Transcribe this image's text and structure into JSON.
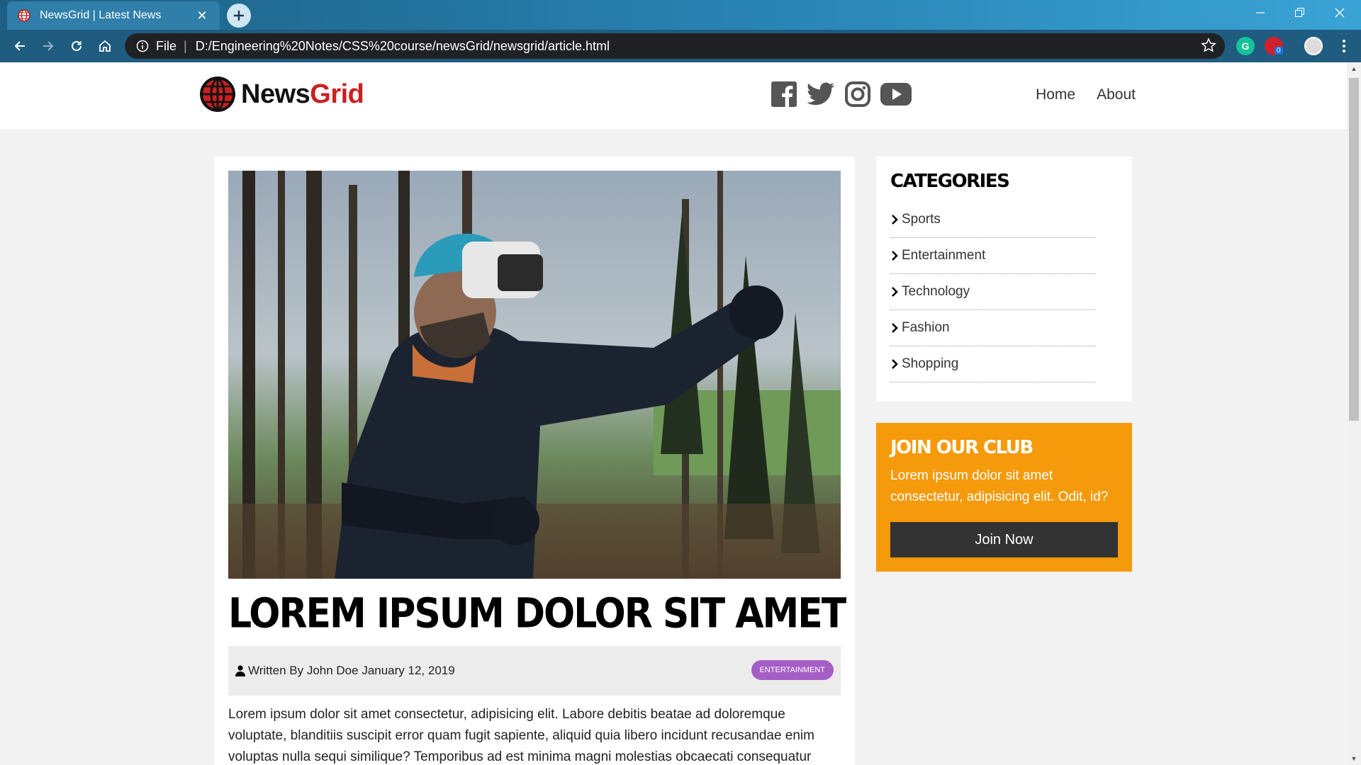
{
  "browser": {
    "tab_title": "NewsGrid | Latest News",
    "scheme_label": "File",
    "url": "D:/Engineering%20Notes/CSS%20course/newsGrid/newsgrid/article.html",
    "extension_badge": "0",
    "colors": {
      "titlebar": "#2883b3",
      "toolbar": "#1f5c7f",
      "omnibox": "#202124"
    }
  },
  "site": {
    "logo_news": "News",
    "logo_grid": "Grid",
    "social_icons": [
      "facebook-icon",
      "twitter-icon",
      "instagram-icon",
      "youtube-icon"
    ],
    "nav": [
      {
        "label": "Home"
      },
      {
        "label": "About"
      }
    ]
  },
  "article": {
    "title": "LOREM IPSUM DOLOR SIT AMET",
    "author_line": "Written By John Doe January 12, 2019",
    "category_badge": "ENTERTAINMENT",
    "body": "Lorem ipsum dolor sit amet consectetur, adipisicing elit. Labore debitis beatae ad doloremque voluptate, blanditiis suscipit error quam fugit sapiente, aliquid quia libero incidunt recusandae enim voluptas nulla sequi similique? Temporibus ad est minima magni molestias obcaecati consequatur"
  },
  "sidebar": {
    "categories_heading": "CATEGORIES",
    "categories": [
      {
        "label": "Sports"
      },
      {
        "label": "Entertainment"
      },
      {
        "label": "Technology"
      },
      {
        "label": "Fashion"
      },
      {
        "label": "Shopping"
      }
    ],
    "club": {
      "heading": "JOIN OUR CLUB",
      "text": "Lorem ipsum dolor sit amet consectetur, adipisicing elit. Odit, id?",
      "button": "Join Now"
    }
  },
  "colors": {
    "brand_red": "#cc1f1f",
    "badge_purple": "#a45ec5",
    "club_orange": "#f59a0a",
    "button_dark": "#333333"
  }
}
